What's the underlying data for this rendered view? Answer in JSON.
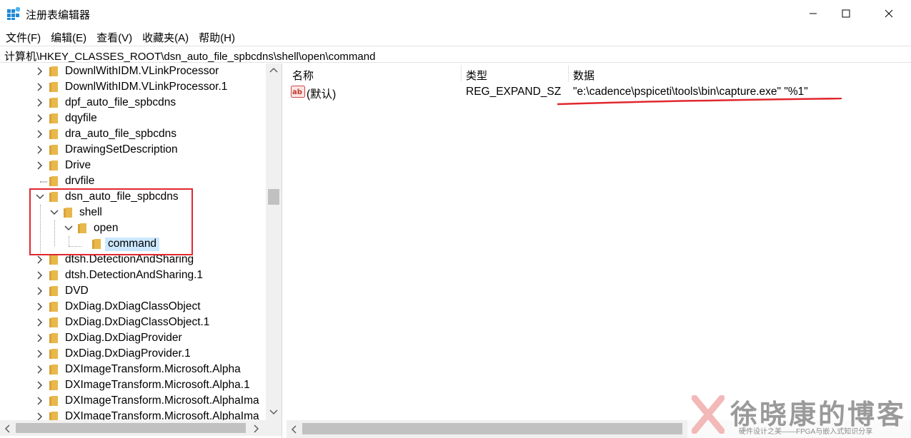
{
  "window": {
    "title": "注册表编辑器",
    "controls": [
      "minimize",
      "maximize",
      "close"
    ]
  },
  "menu": [
    "文件(F)",
    "编辑(E)",
    "查看(V)",
    "收藏夹(A)",
    "帮助(H)"
  ],
  "address": "计算机\\HKEY_CLASSES_ROOT\\dsn_auto_file_spbcdns\\shell\\open\\command",
  "tree": {
    "items": [
      {
        "label": "DownlWithIDM.VLinkProcessor",
        "expanded": false
      },
      {
        "label": "DownlWithIDM.VLinkProcessor.1",
        "expanded": false
      },
      {
        "label": "dpf_auto_file_spbcdns",
        "expanded": false
      },
      {
        "label": "dqyfile",
        "expanded": false
      },
      {
        "label": "dra_auto_file_spbcdns",
        "expanded": false
      },
      {
        "label": "DrawingSetDescription",
        "expanded": false
      },
      {
        "label": "Drive",
        "expanded": false
      },
      {
        "label": "drvfile",
        "expanded": false
      },
      {
        "label": "dsn_auto_file_spbcdns",
        "expanded": true
      },
      {
        "label": "shell",
        "expanded": true
      },
      {
        "label": "open",
        "expanded": true
      },
      {
        "label": "command",
        "selected": true
      },
      {
        "label": "dtsh.DetectionAndSharing",
        "expanded": false
      },
      {
        "label": "dtsh.DetectionAndSharing.1",
        "expanded": false
      },
      {
        "label": "DVD",
        "expanded": false
      },
      {
        "label": "DxDiag.DxDiagClassObject",
        "expanded": false
      },
      {
        "label": "DxDiag.DxDiagClassObject.1",
        "expanded": false
      },
      {
        "label": "DxDiag.DxDiagProvider",
        "expanded": false
      },
      {
        "label": "DxDiag.DxDiagProvider.1",
        "expanded": false
      },
      {
        "label": "DXImageTransform.Microsoft.Alpha",
        "expanded": false
      },
      {
        "label": "DXImageTransform.Microsoft.Alpha.1",
        "expanded": false
      },
      {
        "label": "DXImageTransform.Microsoft.AlphaIma",
        "expanded": false
      },
      {
        "label": "DXImageTransform.Microsoft.AlphaIma",
        "expanded": false
      }
    ]
  },
  "list": {
    "columns": [
      "名称",
      "类型",
      "数据"
    ],
    "rows": [
      {
        "name": "(默认)",
        "type": "REG_EXPAND_SZ",
        "data": "\"e:\\cadence\\pspiceti\\tools\\bin\\capture.exe\" \"%1\""
      }
    ]
  },
  "watermark": {
    "title": "徐晓康的博客",
    "subtitle": "硬件设计之美——FPGA与嵌入式知识分享"
  },
  "colors": {
    "folder": "#e8b84a",
    "selection": "#cce8ff",
    "highlight_box": "#e1282f"
  }
}
